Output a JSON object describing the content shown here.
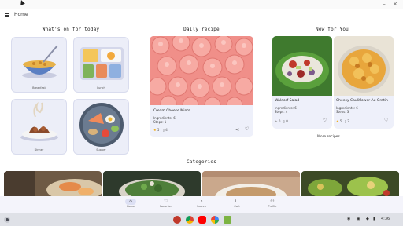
{
  "window": {
    "minimize": "–",
    "close": "×"
  },
  "appbar": {
    "title": "Home"
  },
  "sections": {
    "whats_on": "What's on for today",
    "daily": "Daily recipe",
    "new_for_you": "New for You",
    "categories": "Categories"
  },
  "meals": [
    {
      "label": "Breakfast"
    },
    {
      "label": "Lunch"
    },
    {
      "label": "Dinner"
    },
    {
      "label": "Supper"
    }
  ],
  "daily_recipe": {
    "name": "Cream Cheese Mints",
    "ingredients": "Ingredients: 6",
    "steps": "Steps: 1",
    "rating": "5",
    "reviews": "4"
  },
  "new_recipes": [
    {
      "name": "Waldorf Salad",
      "ingredients": "Ingredients: 6",
      "steps": "Steps: 4",
      "rating": "0",
      "reviews": "0"
    },
    {
      "name": "Cheesy Cauliflower Au Gratin",
      "ingredients": "Ingredients: 6",
      "steps": "Steps: 3",
      "rating": "5",
      "reviews": "2"
    }
  ],
  "more_recipes": "More recipes",
  "bottom_nav": [
    {
      "label": "Home",
      "active": true
    },
    {
      "label": "Favorites"
    },
    {
      "label": "Search"
    },
    {
      "label": "Cart"
    },
    {
      "label": "Profile"
    }
  ],
  "shelf": {
    "time": "4:36"
  },
  "colors": {
    "star": "#f0a400",
    "card_bg": "#eef0fa",
    "nav_active": "#dde0f4"
  }
}
